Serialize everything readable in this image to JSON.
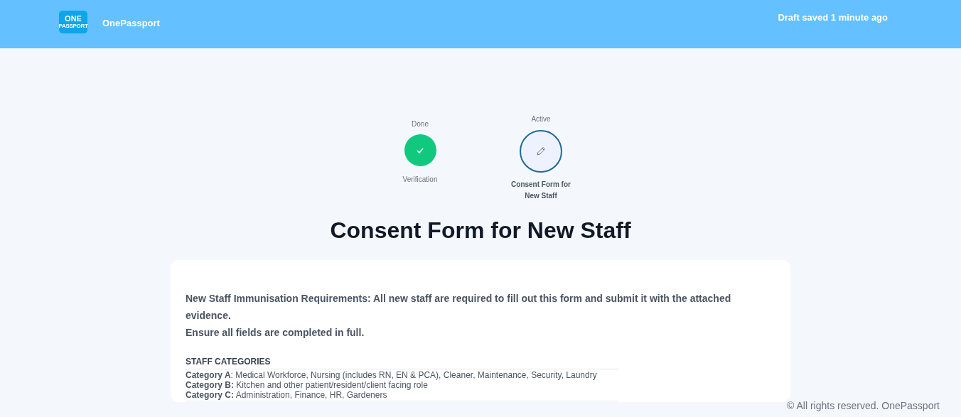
{
  "header": {
    "logo": {
      "top": "ONE",
      "bottom": "PASSPORT"
    },
    "brand": "OnePassport",
    "draft_status": "Draft saved 1 minute ago"
  },
  "steps": [
    {
      "kind": "done",
      "status": "Done",
      "name": "Verification"
    },
    {
      "kind": "active",
      "status": "Active",
      "name": "Consent Form for New Staff"
    }
  ],
  "title": "Consent Form for New Staff",
  "intro": [
    "New Staff Immunisation Requirements:  All new staff are required to fill out this form and submit it with the attached evidence.",
    "Ensure all fields are completed in full."
  ],
  "staff_categories": {
    "heading": "STAFF CATEGORIES",
    "rows": [
      "**Category A**: Medical Workforce, Nursing (includes RN, EN & PCA), Cleaner, Maintenance, Security, Laundry",
      "**Category B:** Kitchen and other patient/resident/client facing role",
      "**Category C:** Administration, Finance, HR, Gardeners"
    ]
  },
  "footer": "© All rights reserved. OnePassport"
}
